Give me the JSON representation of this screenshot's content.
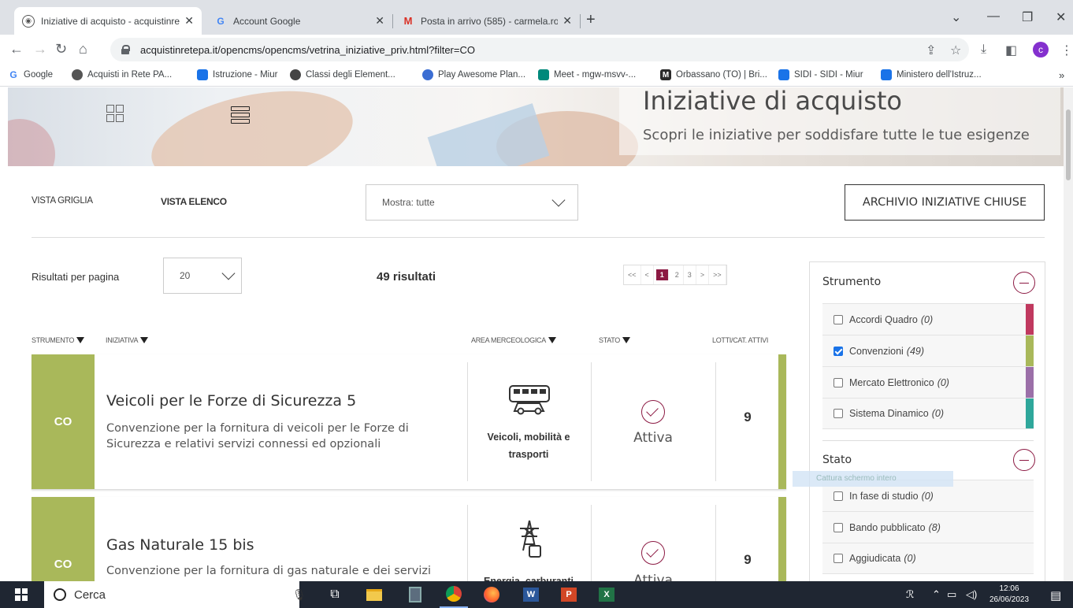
{
  "browser": {
    "tabs": [
      {
        "label": "Iniziative di acquisto - acquistinre",
        "icon": "globe-icon",
        "active": true
      },
      {
        "label": "Account Google",
        "icon": "google-icon",
        "active": false
      },
      {
        "label": "Posta in arrivo (585) - carmela.ro",
        "icon": "gmail-icon",
        "active": false
      }
    ],
    "new_tab": "+",
    "url": "acquistinretepa.it/opencms/opencms/vetrina_iniziative_priv.html?filter=CO",
    "profile_initial": "c",
    "bookmarks": [
      {
        "label": "Google",
        "color": "#4285f4"
      },
      {
        "label": "Acquisti in Rete PA...",
        "color": "#555555"
      },
      {
        "label": "Istruzione - Miur",
        "color": "#1a73e8"
      },
      {
        "label": "Classi degli Element...",
        "color": "#444444"
      },
      {
        "label": "Play Awesome Plan...",
        "color": "#3b6ed3"
      },
      {
        "label": "Meet - mgw-msvv-...",
        "color": "#00897b"
      },
      {
        "label": "Orbassano (TO) | Bri...",
        "color": "#2b2b2b"
      },
      {
        "label": "SIDI - SIDI - Miur",
        "color": "#1a73e8"
      },
      {
        "label": "Ministero dell'Istruz...",
        "color": "#1a73e8"
      }
    ],
    "bookmarks_more": "»"
  },
  "hero": {
    "title": "Iniziative di acquisto",
    "subtitle": "Scopri le iniziative per soddisfare tutte le tue esigenze"
  },
  "toolbar": {
    "grid_view_label": "VISTA GRIGLIA",
    "list_view_label": "VISTA ELENCO",
    "show_select": "Mostra: tutte",
    "archive_button": "ARCHIVIO INIZIATIVE CHIUSE"
  },
  "results": {
    "per_page_label": "Risultati per pagina",
    "per_page_value": "20",
    "count_text": "49 risultati",
    "pager": [
      "<<",
      "<",
      "1",
      "2",
      "3",
      ">",
      ">>"
    ],
    "current_page": "1"
  },
  "table_headers": {
    "strumento": "STRUMENTO",
    "iniziativa": "INIZIATIVA",
    "area": "AREA MERCEOLOGICA",
    "stato": "STATO",
    "lotti": "LOTTI/CAT. ATTIVI"
  },
  "initiatives": [
    {
      "code": "CO",
      "title": "Veicoli per le Forze di Sicurezza 5",
      "description": "Convenzione per la fornitura di veicoli per le Forze di Sicurezza e relativi servizi connessi ed opzionali",
      "area": "Veicoli, mobilità e trasporti",
      "area_icon": "bus-car-icon",
      "status": "Attiva",
      "lots": "9"
    },
    {
      "code": "CO",
      "title": "Gas Naturale 15 bis",
      "description": "Convenzione per la fornitura di gas naturale e dei servizi",
      "area": "Energia, carburanti",
      "area_icon": "power-tower-icon",
      "status": "Attiva",
      "lots": "9"
    }
  ],
  "filters": {
    "strumento": {
      "heading": "Strumento",
      "items": [
        {
          "label": "Accordi Quadro",
          "count": "(0)",
          "checked": false,
          "color": "#c0395f"
        },
        {
          "label": "Convenzioni",
          "count": "(49)",
          "checked": true,
          "color": "#a9b85a"
        },
        {
          "label": "Mercato Elettronico",
          "count": "(0)",
          "checked": false,
          "color": "#9b6fa8"
        },
        {
          "label": "Sistema Dinamico",
          "count": "(0)",
          "checked": false,
          "color": "#2fa79b"
        }
      ]
    },
    "stato": {
      "heading": "Stato",
      "items": [
        {
          "label": "In fase di studio",
          "count": "(0)",
          "checked": false
        },
        {
          "label": "Bando pubblicato",
          "count": "(8)",
          "checked": false
        },
        {
          "label": "Aggiudicata",
          "count": "(0)",
          "checked": false
        }
      ]
    }
  },
  "tooltip": "Cattura schermo intero",
  "taskbar": {
    "search_placeholder": "Cerca",
    "time": "12:06",
    "date": "26/06/2023"
  }
}
